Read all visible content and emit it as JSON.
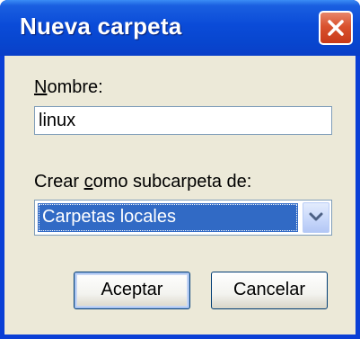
{
  "window": {
    "title": "Nueva carpeta"
  },
  "name_label": {
    "prefix": "",
    "accel": "N",
    "suffix": "ombre:"
  },
  "name_input": {
    "value": "linux"
  },
  "parent_label": {
    "prefix": "Crear ",
    "accel": "c",
    "suffix": "omo subcarpeta de:"
  },
  "parent_select": {
    "selected": "Carpetas locales"
  },
  "buttons": {
    "accept": "Aceptar",
    "cancel": "Cancelar"
  },
  "icons": {
    "close": "close-icon",
    "dropdown": "chevron-down-icon"
  },
  "colors": {
    "titlebar": "#0a4bd8",
    "close_button": "#d9522e",
    "client_background": "#ece9d8",
    "selection": "#316ac5",
    "button_border": "#003c74"
  }
}
